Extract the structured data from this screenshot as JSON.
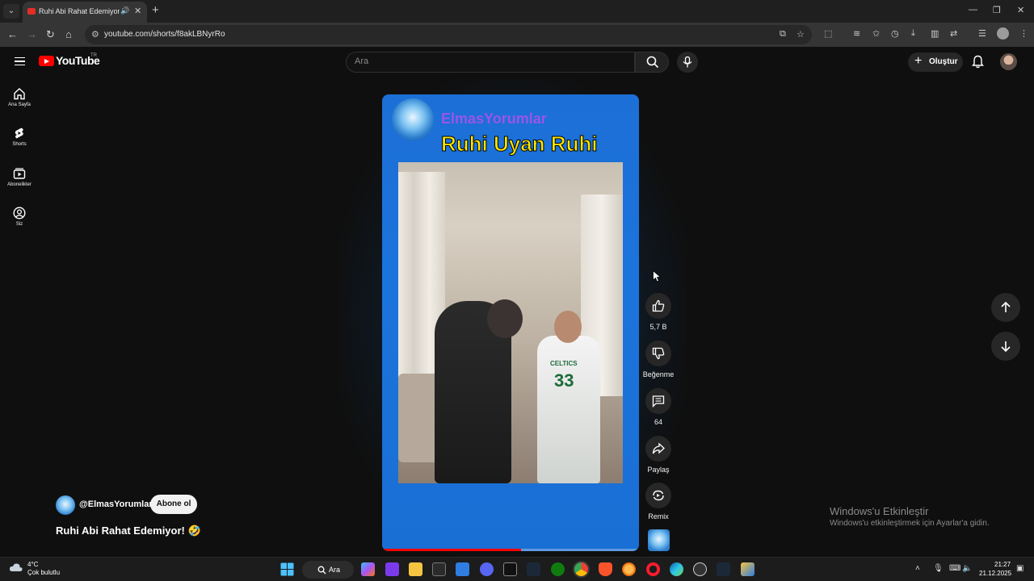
{
  "browser": {
    "tab_title": "Ruhi Abi Rahat Edemiyor! 🤣",
    "tab_status_icons": "🔊",
    "url": "youtube.com/shorts/f8akLBNyrRo"
  },
  "youtube": {
    "logo_text": "YouTube",
    "country_code": "TR",
    "search_placeholder": "Ara",
    "create_label": "Oluştur"
  },
  "guide": {
    "items": [
      {
        "label": "Ana Sayfa",
        "icon": "home-icon"
      },
      {
        "label": "Shorts",
        "icon": "shorts-icon"
      },
      {
        "label": "Abonelikler",
        "icon": "subscriptions-icon"
      },
      {
        "label": "Siz",
        "icon": "you-icon"
      }
    ]
  },
  "video": {
    "overlay_brand": "ElmasYorumlar",
    "overlay_title": "Ruhi Uyan Ruhi",
    "jersey_text": "CELTICS",
    "jersey_number": "33",
    "progress_fraction": 0.54
  },
  "actions": {
    "like_count": "5,7 B",
    "dislike_label": "Beğenme",
    "comment_count": "64",
    "share_label": "Paylaş",
    "remix_label": "Remix"
  },
  "channel": {
    "handle": "@ElmasYorumlar",
    "subscribe_label": "Abone ol",
    "short_title": "Ruhi Abi Rahat Edemiyor! 🤣"
  },
  "watermark": {
    "title": "Windows'u Etkinleştir",
    "subtitle": "Windows'u etkinleştirmek için Ayarlar'a gidin."
  },
  "taskbar": {
    "temperature": "4°C",
    "weather_desc": "Çok bulutlu",
    "search_label": "Ara",
    "time": "21:27",
    "date": "21.12.2025"
  },
  "colors": {
    "accent_red": "#ff0000",
    "player_blue": "#1b74dc",
    "overlay_yellow": "#ffe600",
    "overlay_purple": "#9a55e8"
  }
}
